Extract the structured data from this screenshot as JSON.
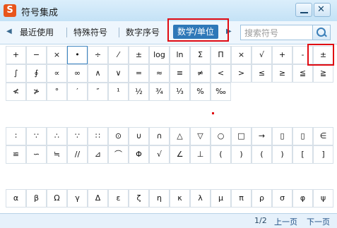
{
  "window": {
    "title": "符号集成",
    "app_icon": "S",
    "minimize_label": "",
    "close_label": "✕"
  },
  "tabs": [
    {
      "label": "最近使用"
    },
    {
      "label": "特殊符号"
    },
    {
      "label": "数字序号"
    },
    {
      "label": "数学/单位"
    }
  ],
  "search": {
    "placeholder": "搜索符号"
  },
  "grid1": [
    [
      "+",
      "−",
      "×",
      "•",
      "÷",
      "⁄",
      "±",
      "log",
      "ln",
      "Σ",
      "Π",
      "×",
      "√",
      "+",
      "-",
      "±"
    ],
    [
      "∫",
      "∮",
      "∝",
      "∞",
      "∧",
      "∨",
      "=",
      "≈",
      "≡",
      "≠",
      "<",
      ">",
      "≤",
      "≥",
      "≦",
      "≧"
    ],
    [
      "≮",
      "≯",
      "°",
      "′",
      "″",
      "¹",
      "½",
      "¾",
      "⅓",
      "%",
      "‰"
    ]
  ],
  "grid2": [
    [
      "∶",
      "∵",
      "∴",
      "∵",
      "∷",
      "⊙",
      "∪",
      "∩",
      "△",
      "▽",
      "○",
      "□",
      "→",
      "▯",
      "▯",
      "∈"
    ],
    [
      "≌",
      "∽",
      "≒",
      "//",
      "⊿",
      "⌒",
      "Φ",
      "√",
      "∠",
      "⊥",
      "(",
      ")",
      "(",
      ")",
      "[",
      "]"
    ]
  ],
  "grid3": [
    [
      "α",
      "β",
      "Ω",
      "γ",
      "Δ",
      "ε",
      "ζ",
      "η",
      "κ",
      "λ",
      "μ",
      "π",
      "ρ",
      "σ",
      "φ",
      "ψ"
    ]
  ],
  "footer": {
    "page": "1/2",
    "prev": "上一页",
    "next": "下一页"
  },
  "colors": {
    "accent": "#2e78b8",
    "highlight": "#e00a12"
  }
}
